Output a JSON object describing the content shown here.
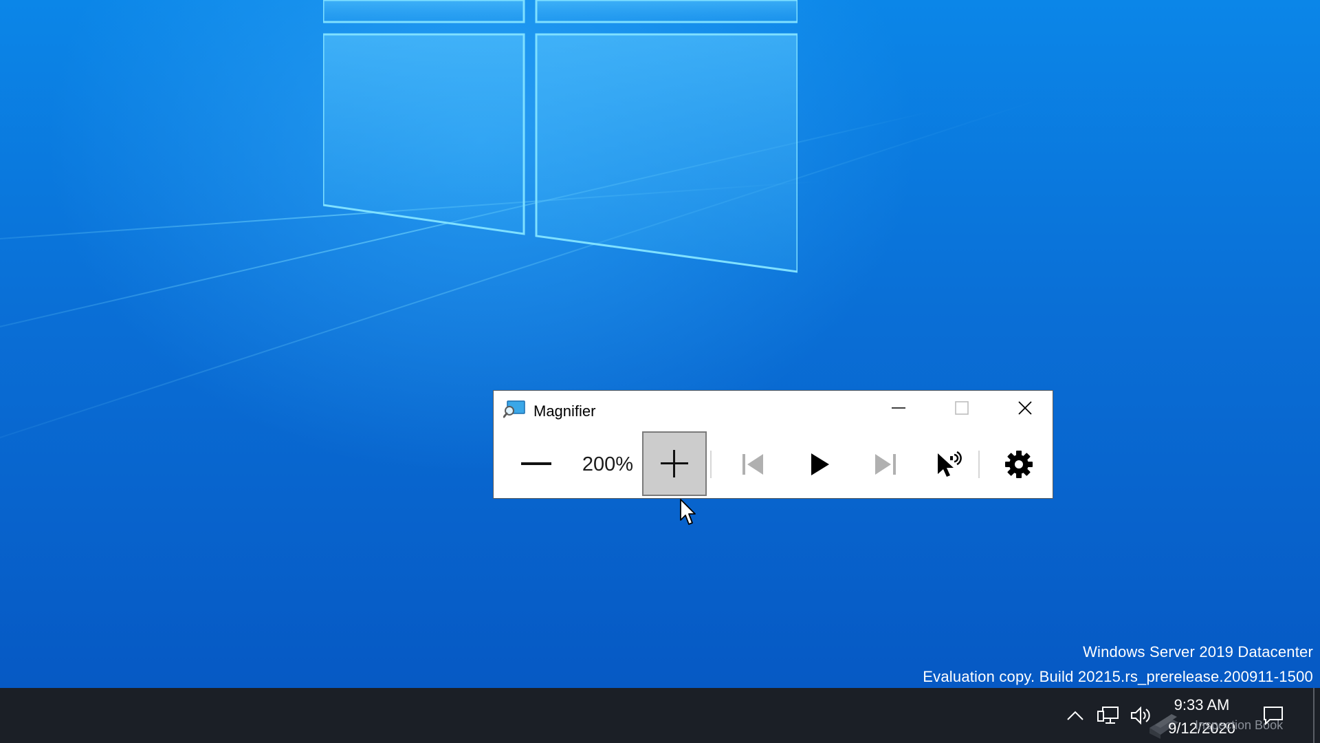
{
  "window": {
    "title": "Magnifier",
    "zoom_level": "200%",
    "controls": {
      "minimize": "minimize-icon",
      "maximize": "maximize-icon",
      "close": "close-icon"
    },
    "toolbar_icons": [
      "zoom-out-icon",
      "zoom-in-icon",
      "previous-paragraph-icon",
      "play-icon",
      "next-paragraph-icon",
      "read-from-here-icon",
      "settings-gear-icon"
    ]
  },
  "desktop": {
    "watermark_line1": "Windows Server 2019 Datacenter",
    "watermark_line2": "Evaluation copy. Build 20215.rs_prerelease.200911-1500"
  },
  "taskbar": {
    "time": "9:33 AM",
    "date": "9/12/2020",
    "overlay_text": "Inspection Book"
  },
  "colors": {
    "desktop": "#0a6fd6",
    "taskbar": "#1b1f26",
    "active_button": "#cccccc"
  }
}
